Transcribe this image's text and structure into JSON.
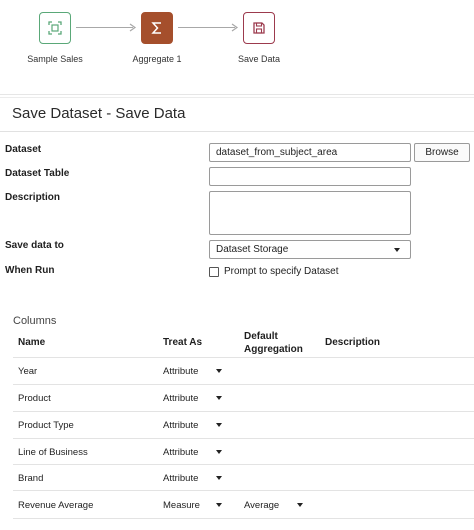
{
  "flow": {
    "nodes": [
      {
        "label": "Sample Sales",
        "icon": "dataset-source-icon",
        "color": "#5aa878"
      },
      {
        "label": "Aggregate 1",
        "icon": "sigma-icon",
        "color": "#a54f2c"
      },
      {
        "label": "Save Data",
        "icon": "save-icon",
        "color": "#9c3a4d"
      }
    ]
  },
  "panel": {
    "title": "Save Dataset - Save Data"
  },
  "form": {
    "dataset_label": "Dataset",
    "dataset_value": "dataset_from_subject_area",
    "browse_label": "Browse",
    "dataset_table_label": "Dataset Table",
    "dataset_table_value": "",
    "description_label": "Description",
    "description_value": "",
    "save_to_label": "Save data to",
    "save_to_value": "Dataset Storage",
    "when_run_label": "When Run",
    "prompt_label": "Prompt to specify Dataset",
    "prompt_checked": false
  },
  "columns": {
    "section_title": "Columns",
    "headers": {
      "name": "Name",
      "treat_as": "Treat As",
      "default_aggregation": "Default Aggregation",
      "description": "Description"
    },
    "rows": [
      {
        "name": "Year",
        "treat_as": "Attribute",
        "aggregation": ""
      },
      {
        "name": "Product",
        "treat_as": "Attribute",
        "aggregation": ""
      },
      {
        "name": "Product Type",
        "treat_as": "Attribute",
        "aggregation": ""
      },
      {
        "name": "Line of Business",
        "treat_as": "Attribute",
        "aggregation": ""
      },
      {
        "name": "Brand",
        "treat_as": "Attribute",
        "aggregation": ""
      },
      {
        "name": "Revenue Average",
        "treat_as": "Measure",
        "aggregation": "Average"
      }
    ]
  }
}
